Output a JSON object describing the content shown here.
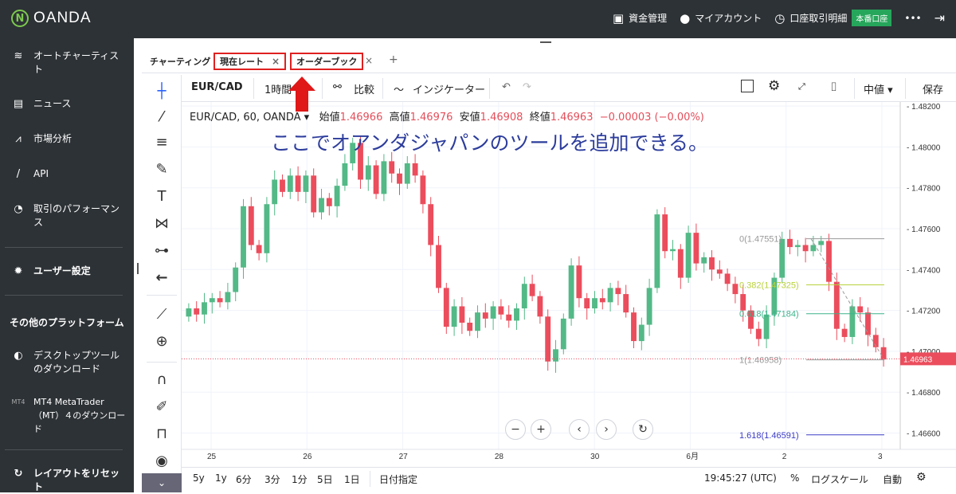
{
  "brand": {
    "name": "OANDA"
  },
  "topnav": {
    "funds": "資金管理",
    "account": "マイアカウント",
    "history": "口座取引明細",
    "badge": "本番口座",
    "more": "•••"
  },
  "sidebar": {
    "items": [
      {
        "label": "オートチャーティスト",
        "icon": "autochartist-icon"
      },
      {
        "label": "ニュース",
        "icon": "news-icon"
      },
      {
        "label": "市場分析",
        "icon": "analysis-icon"
      },
      {
        "label": "API",
        "icon": "api-icon"
      },
      {
        "label": "取引のパフォーマンス",
        "icon": "gauge-icon"
      }
    ],
    "settings": "ユーザー設定",
    "other_heading": "その他のプラットフォーム",
    "desktop": "デスクトップツールのダウンロード",
    "mt4_tag": "MT4",
    "mt4": "MT4 MetaTrader（MT）４のダウンロード",
    "reset": "レイアウトをリセット"
  },
  "tabs": {
    "chart": "チャーティング",
    "rate": "現在レート",
    "orderbook": "オーダーブック",
    "add": "+"
  },
  "toolbar": {
    "symbol": "EUR/CAD",
    "interval": "1時間",
    "compare": "比較",
    "indicator": "インジケーター",
    "midprice": "中値",
    "save": "保存"
  },
  "legend": {
    "instrument": "EUR/CAD, 60, OANDA",
    "open_label": "始値",
    "open": "1.46966",
    "high_label": "高値",
    "high": "1.46976",
    "low_label": "安値",
    "low": "1.46908",
    "close_label": "終値",
    "close": "1.46963",
    "change": "−0.00003 (−0.00%)"
  },
  "annotation": "ここでオアンダジャパンのツールを追加できる。",
  "bottom": {
    "ranges": [
      "5y",
      "1y",
      "6分",
      "3分",
      "1分",
      "5日",
      "1日"
    ],
    "date_jump": "日付指定",
    "time": "19:45:27 (UTC)",
    "percent": "%",
    "log": "ログスケール",
    "auto": "自動"
  },
  "chart_data": {
    "type": "candlestick",
    "title": "EUR/CAD, 60, OANDA",
    "ylim": [
      1.4652,
      1.4822
    ],
    "y_ticks": [
      "1.48200",
      "1.48000",
      "1.47800",
      "1.47600",
      "1.47400",
      "1.47200",
      "1.47000",
      "1.46800",
      "1.46600"
    ],
    "x_ticks": [
      "25",
      "26",
      "27",
      "28",
      "30",
      "6月",
      "2",
      "3"
    ],
    "current_price": "1.46963",
    "fibonacci": [
      {
        "label": "0(1.47551)",
        "value": 1.47551,
        "color": "#999999"
      },
      {
        "label": "0.382(1.47325)",
        "value": 1.47325,
        "color": "#b8d23c"
      },
      {
        "label": "0.618(1.47184)",
        "value": 1.47184,
        "color": "#3cb48c"
      },
      {
        "label": "1(1.46958)",
        "value": 1.46958,
        "color": "#999999"
      },
      {
        "label": "1.618(1.46591)",
        "value": 1.46591,
        "color": "#3c3cc8"
      }
    ],
    "close_path": [
      1.4721,
      1.4718,
      1.4724,
      1.4726,
      1.4724,
      1.4729,
      1.4741,
      1.4771,
      1.4752,
      1.4748,
      1.4772,
      1.4784,
      1.4778,
      1.4786,
      1.4778,
      1.4786,
      1.4768,
      1.4775,
      1.4771,
      1.4781,
      1.4792,
      1.4802,
      1.4784,
      1.4791,
      1.4777,
      1.4793,
      1.4787,
      1.4782,
      1.4792,
      1.4786,
      1.4772,
      1.4752,
      1.4731,
      1.4712,
      1.4722,
      1.4714,
      1.471,
      1.4719,
      1.4716,
      1.4722,
      1.4718,
      1.4715,
      1.4721,
      1.4733,
      1.4727,
      1.4717,
      1.4695,
      1.4701,
      1.4716,
      1.4742,
      1.4726,
      1.4721,
      1.4726,
      1.4724,
      1.4731,
      1.4728,
      1.4719,
      1.4705,
      1.4713,
      1.4731,
      1.4767,
      1.4749,
      1.475,
      1.4736,
      1.4758,
      1.4743,
      1.4746,
      1.474,
      1.4738,
      1.4733,
      1.4728,
      1.472,
      1.4711,
      1.4706,
      1.4718,
      1.4736,
      1.4755,
      1.4751,
      1.4752,
      1.4749,
      1.4752,
      1.4754,
      1.4734,
      1.4711,
      1.4707,
      1.4722,
      1.4719,
      1.4708,
      1.4702,
      1.4696
    ]
  }
}
